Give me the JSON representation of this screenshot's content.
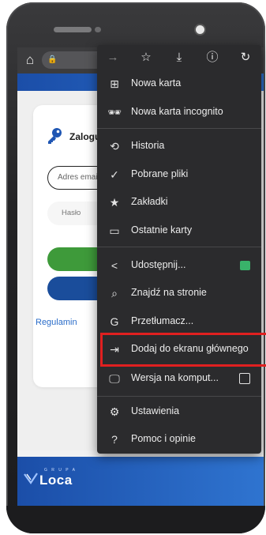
{
  "page": {
    "login_title": "Zalogu",
    "email_placeholder": "Adres email",
    "password_label": "Hasło",
    "terms_link": "Regulamin",
    "footer_logo_small": "G R U P A",
    "footer_logo_text": "Loca"
  },
  "menu": {
    "toolbar": [
      {
        "name": "forward",
        "glyph": "→"
      },
      {
        "name": "bookmark-star",
        "glyph": "☆"
      },
      {
        "name": "download",
        "glyph": "⤓"
      },
      {
        "name": "info",
        "glyph": "ⓘ"
      },
      {
        "name": "reload",
        "glyph": "↻"
      }
    ],
    "items": [
      {
        "label": "Nowa karta",
        "icon": "plus-box-icon",
        "glyph": "⊞"
      },
      {
        "label": "Nowa karta incognito",
        "icon": "incognito-icon",
        "glyph": "🕶"
      },
      {
        "label": "Historia",
        "icon": "history-icon",
        "glyph": "⟲"
      },
      {
        "label": "Pobrane pliki",
        "icon": "download-check-icon",
        "glyph": "✓"
      },
      {
        "label": "Zakładki",
        "icon": "star-icon",
        "glyph": "★"
      },
      {
        "label": "Ostatnie karty",
        "icon": "recent-tabs-icon",
        "glyph": "▭"
      },
      {
        "label": "Udostępnij...",
        "icon": "share-icon",
        "glyph": "<"
      },
      {
        "label": "Znajdź na stronie",
        "icon": "find-in-page-icon",
        "glyph": "⌕"
      },
      {
        "label": "Przetłumacz...",
        "icon": "translate-icon",
        "glyph": "G"
      },
      {
        "label": "Dodaj do ekranu głównego",
        "icon": "add-to-home-icon",
        "glyph": "⇥"
      },
      {
        "label": "Wersja na komput...",
        "icon": "desktop-icon",
        "glyph": "🖵"
      },
      {
        "label": "Ustawienia",
        "icon": "settings-gear-icon",
        "glyph": "⚙"
      },
      {
        "label": "Pomoc i opinie",
        "icon": "help-icon",
        "glyph": "?"
      }
    ]
  },
  "colors": {
    "menu_bg": "#2b2b2d",
    "highlight": "#e02020",
    "brand_blue": "#1b4ea8",
    "brand_green": "#3e9a3a"
  }
}
